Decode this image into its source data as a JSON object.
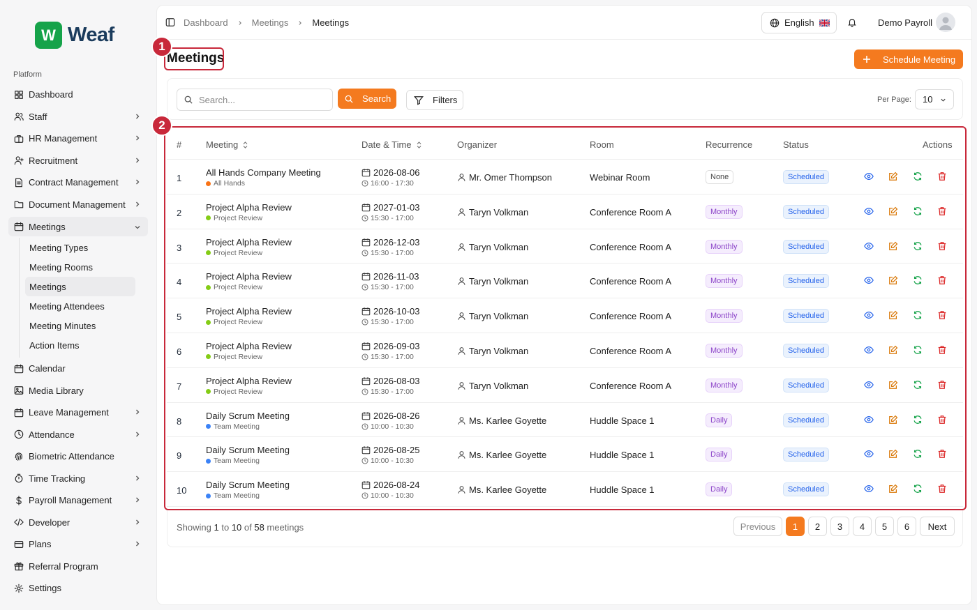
{
  "brand": {
    "logo_letter": "W",
    "name": "Weaf",
    "color": "#16a34a"
  },
  "sidebar": {
    "section_label": "Platform",
    "items": [
      {
        "label": "Dashboard",
        "icon": "grid-icon",
        "chevron": false
      },
      {
        "label": "Staff",
        "icon": "users-icon",
        "chevron": true
      },
      {
        "label": "HR Management",
        "icon": "briefcase-icon",
        "chevron": true
      },
      {
        "label": "Recruitment",
        "icon": "user-plus-icon",
        "chevron": true
      },
      {
        "label": "Contract Management",
        "icon": "file-icon",
        "chevron": true
      },
      {
        "label": "Document Management",
        "icon": "folder-icon",
        "chevron": true
      },
      {
        "label": "Meetings",
        "icon": "calendar-icon",
        "chevron": true,
        "expanded": true
      }
    ],
    "meetings_subitems": [
      "Meeting Types",
      "Meeting Rooms",
      "Meetings",
      "Meeting Attendees",
      "Meeting Minutes",
      "Action Items"
    ],
    "items_after": [
      {
        "label": "Calendar",
        "icon": "calendar-icon",
        "chevron": false
      },
      {
        "label": "Media Library",
        "icon": "image-icon",
        "chevron": false
      },
      {
        "label": "Leave Management",
        "icon": "calendar-icon",
        "chevron": true
      },
      {
        "label": "Attendance",
        "icon": "clock-icon",
        "chevron": true
      },
      {
        "label": "Biometric Attendance",
        "icon": "fingerprint-icon",
        "chevron": false
      },
      {
        "label": "Time Tracking",
        "icon": "timer-icon",
        "chevron": true
      },
      {
        "label": "Payroll Management",
        "icon": "dollar-icon",
        "chevron": true
      },
      {
        "label": "Developer",
        "icon": "code-icon",
        "chevron": true
      },
      {
        "label": "Plans",
        "icon": "card-icon",
        "chevron": true
      },
      {
        "label": "Referral Program",
        "icon": "gift-icon",
        "chevron": false
      },
      {
        "label": "Settings",
        "icon": "gear-icon",
        "chevron": false
      }
    ]
  },
  "header": {
    "breadcrumb": [
      "Dashboard",
      "Meetings",
      "Meetings"
    ],
    "language": "English",
    "user_name": "Demo Payroll"
  },
  "page": {
    "title": "Meetings",
    "schedule_button": "Schedule Meeting",
    "search_placeholder": "Search...",
    "search_button": "Search",
    "filters_button": "Filters",
    "per_page_label": "Per Page:",
    "per_page_value": "10",
    "accent_color": "#f47a1f"
  },
  "annotations": [
    "1",
    "2"
  ],
  "table": {
    "headers": [
      "#",
      "Meeting",
      "Date & Time",
      "Organizer",
      "Room",
      "Recurrence",
      "Status",
      "Actions"
    ],
    "rows": [
      {
        "num": "1",
        "title": "All Hands Company Meeting",
        "type": "All Hands",
        "type_color": "#f97316",
        "date": "2026-08-06",
        "time": "16:00 - 17:30",
        "organizer": "Mr. Omer Thompson",
        "room": "Webinar Room",
        "recurrence": "None",
        "status": "Scheduled"
      },
      {
        "num": "2",
        "title": "Project Alpha Review",
        "type": "Project Review",
        "type_color": "#84cc16",
        "date": "2027-01-03",
        "time": "15:30 - 17:00",
        "organizer": "Taryn Volkman",
        "room": "Conference Room A",
        "recurrence": "Monthly",
        "status": "Scheduled"
      },
      {
        "num": "3",
        "title": "Project Alpha Review",
        "type": "Project Review",
        "type_color": "#84cc16",
        "date": "2026-12-03",
        "time": "15:30 - 17:00",
        "organizer": "Taryn Volkman",
        "room": "Conference Room A",
        "recurrence": "Monthly",
        "status": "Scheduled"
      },
      {
        "num": "4",
        "title": "Project Alpha Review",
        "type": "Project Review",
        "type_color": "#84cc16",
        "date": "2026-11-03",
        "time": "15:30 - 17:00",
        "organizer": "Taryn Volkman",
        "room": "Conference Room A",
        "recurrence": "Monthly",
        "status": "Scheduled"
      },
      {
        "num": "5",
        "title": "Project Alpha Review",
        "type": "Project Review",
        "type_color": "#84cc16",
        "date": "2026-10-03",
        "time": "15:30 - 17:00",
        "organizer": "Taryn Volkman",
        "room": "Conference Room A",
        "recurrence": "Monthly",
        "status": "Scheduled"
      },
      {
        "num": "6",
        "title": "Project Alpha Review",
        "type": "Project Review",
        "type_color": "#84cc16",
        "date": "2026-09-03",
        "time": "15:30 - 17:00",
        "organizer": "Taryn Volkman",
        "room": "Conference Room A",
        "recurrence": "Monthly",
        "status": "Scheduled"
      },
      {
        "num": "7",
        "title": "Project Alpha Review",
        "type": "Project Review",
        "type_color": "#84cc16",
        "date": "2026-08-03",
        "time": "15:30 - 17:00",
        "organizer": "Taryn Volkman",
        "room": "Conference Room A",
        "recurrence": "Monthly",
        "status": "Scheduled"
      },
      {
        "num": "8",
        "title": "Daily Scrum Meeting",
        "type": "Team Meeting",
        "type_color": "#3b82f6",
        "date": "2026-08-26",
        "time": "10:00 - 10:30",
        "organizer": "Ms. Karlee Goyette",
        "room": "Huddle Space 1",
        "recurrence": "Daily",
        "status": "Scheduled"
      },
      {
        "num": "9",
        "title": "Daily Scrum Meeting",
        "type": "Team Meeting",
        "type_color": "#3b82f6",
        "date": "2026-08-25",
        "time": "10:00 - 10:30",
        "organizer": "Ms. Karlee Goyette",
        "room": "Huddle Space 1",
        "recurrence": "Daily",
        "status": "Scheduled"
      },
      {
        "num": "10",
        "title": "Daily Scrum Meeting",
        "type": "Team Meeting",
        "type_color": "#3b82f6",
        "date": "2026-08-24",
        "time": "10:00 - 10:30",
        "organizer": "Ms. Karlee Goyette",
        "room": "Huddle Space 1",
        "recurrence": "Daily",
        "status": "Scheduled"
      }
    ]
  },
  "pagination": {
    "summary_prefix": "Showing ",
    "from": "1",
    "to_word": " to ",
    "to": "10",
    "of_word": " of ",
    "total": "58",
    "suffix": " meetings",
    "previous": "Previous",
    "pages": [
      "1",
      "2",
      "3",
      "4",
      "5",
      "6"
    ],
    "current": "1",
    "next": "Next"
  }
}
